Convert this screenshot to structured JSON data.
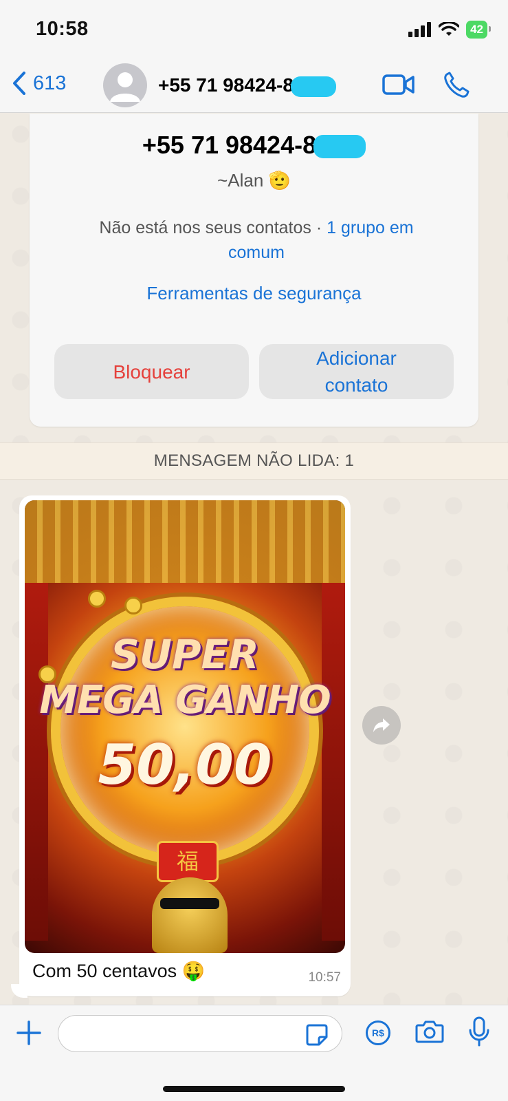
{
  "status_bar": {
    "time": "10:58",
    "battery": "42"
  },
  "nav": {
    "back_count": "613",
    "contact_number": "+55 71 98424-8",
    "icons": [
      "chevron-left-icon",
      "video-icon",
      "phone-icon"
    ]
  },
  "contact_card": {
    "number": "+55 71 98424-8",
    "alias": "~Alan 🫡",
    "not_in_contacts": "Não está nos seus contatos · ",
    "groups_link": "1 grupo em comum",
    "safety_tools": "Ferramentas de segurança",
    "block_label": "Bloquear",
    "add_contact_label": "Adicionar contato"
  },
  "unread_banner": "MENSAGEM NÃO LIDA: 1",
  "message": {
    "image_text_line1": "SUPER",
    "image_text_line2": "MEGA GANHO",
    "image_text_amount": "50,00",
    "caption": "Com 50 centavos 🤑",
    "time": "10:57"
  },
  "colors": {
    "accent": "#1a73d6",
    "danger": "#e5413c",
    "background": "#efeae2"
  }
}
